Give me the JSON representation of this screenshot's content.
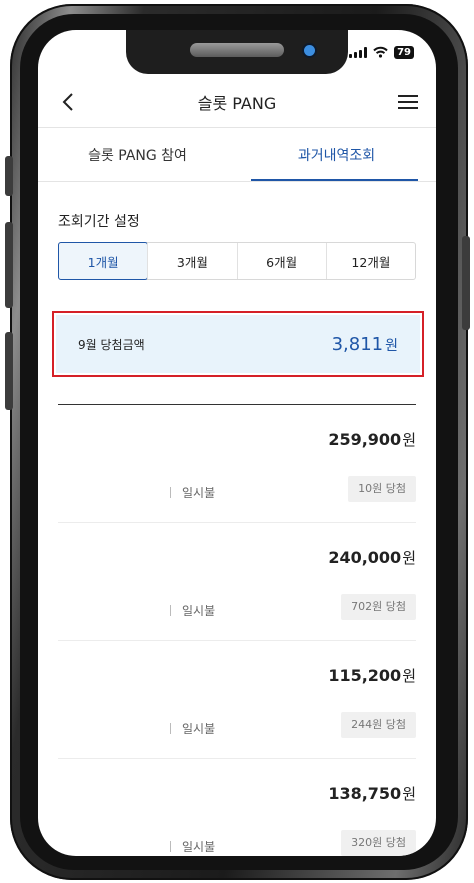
{
  "status_bar": {
    "battery": "79"
  },
  "header": {
    "title": "슬롯 PANG",
    "back_icon": "chevron-left-icon",
    "menu_icon": "hamburger-menu-icon"
  },
  "tabs": [
    {
      "label": "슬롯 PANG 참여",
      "active": false
    },
    {
      "label": "과거내역조회",
      "active": true
    }
  ],
  "period": {
    "label": "조회기간 설정",
    "options": [
      "1개월",
      "3개월",
      "6개월",
      "12개월"
    ],
    "selected": "1개월"
  },
  "summary": {
    "label": "9월 당첨금액",
    "amount": "3,811",
    "unit": "원"
  },
  "transactions": [
    {
      "amount": "259,900",
      "unit": "원",
      "payment": "일시불",
      "badge": "10원 당첨"
    },
    {
      "amount": "240,000",
      "unit": "원",
      "payment": "일시불",
      "badge": "702원 당첨"
    },
    {
      "amount": "115,200",
      "unit": "원",
      "payment": "일시불",
      "badge": "244원 당첨"
    },
    {
      "amount": "138,750",
      "unit": "원",
      "payment": "일시불",
      "badge": "320원 당첨"
    }
  ],
  "colors": {
    "accent": "#1f56a7",
    "highlight_border": "#d52027",
    "summary_bg": "#e8f3fb"
  }
}
